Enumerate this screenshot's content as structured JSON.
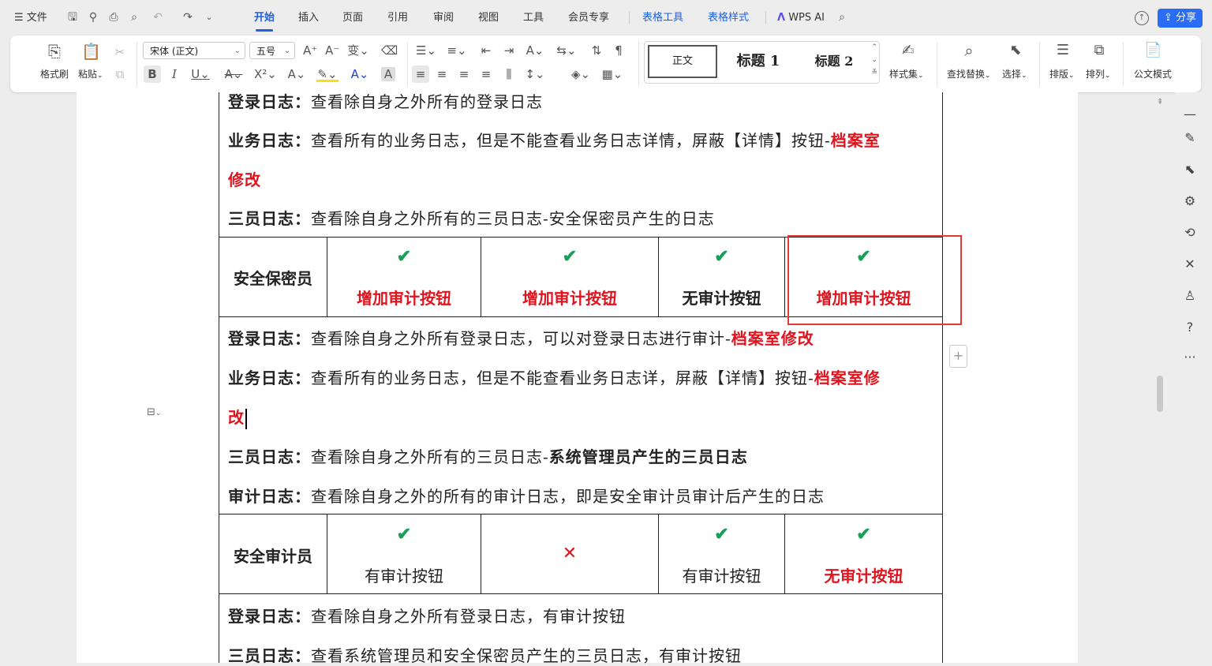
{
  "topbar": {
    "file_menu": "文件",
    "tabs": [
      "开始",
      "插入",
      "页面",
      "引用",
      "审阅",
      "视图",
      "工具",
      "会员专享"
    ],
    "context_tabs": [
      "表格工具",
      "表格样式"
    ],
    "wps_ai": "WPS AI",
    "share": "分享"
  },
  "ribbon": {
    "format_painter": "格式刷",
    "paste": "粘贴",
    "font_name": "宋体 (正文)",
    "font_size": "五号",
    "styles": {
      "normal": "正文",
      "h1": "标题 1",
      "h2": "标题 2"
    },
    "style_set": "样式集",
    "find_replace": "查找替换",
    "select": "选择",
    "layout": "排版",
    "arrange": "排列",
    "official": "公文模式"
  },
  "doc": {
    "p1_label": "登录日志：",
    "p1_text": "查看除自身之外所有的登录日志",
    "p2_label": "业务日志：",
    "p2_text": "查看所有的业务日志，但是不能查看业务日志详情，屏蔽【详情】按钮-",
    "p2_red": "档案室",
    "p2_red2": "修改",
    "p3_label": "三员日志：",
    "p3_text": "查看除自身之外所有的三员日志-安全保密员产生的日志",
    "row1": {
      "role": "安全保密员",
      "c1": "增加审计按钮",
      "c2": "增加审计按钮",
      "c3": "无审计按钮",
      "c4": "增加审计按钮"
    },
    "p4_label": "登录日志：",
    "p4_text": "查看除自身之外所有登录日志，可以对登录日志进行审计-",
    "p4_red": "档案室修改",
    "p5_label": "业务日志：",
    "p5_text": "查看所有的业务日志，但是不能查看业务日志详，屏蔽【详情】按钮-",
    "p5_red": "档案室修",
    "p5_red2": "改",
    "p6_label": "三员日志：",
    "p6_text": "查看除自身之外所有的三员日志-",
    "p6_bold": "系统管理员产生的三员日志",
    "p7_label": "审计日志：",
    "p7_text": "查看除自身之外的所有的审计日志，即是安全审计员审计后产生的日志",
    "row2": {
      "role": "安全审计员",
      "c1": "有审计按钮",
      "c3": "有审计按钮",
      "c4": "无审计按钮"
    },
    "p8_label": "登录日志：",
    "p8_text": "查看除自身之外所有登录日志，有审计按钮",
    "p9_label": "三员日志：",
    "p9_text": "查看系统管理员和安全保密员产生的三员日志，有审计按钮"
  },
  "symbols": {
    "check": "✔",
    "cross": "✕"
  },
  "colors": {
    "accent": "#1f5fe0",
    "red": "#e0141e",
    "green": "#18a058",
    "highlight_box": "#e53935"
  }
}
